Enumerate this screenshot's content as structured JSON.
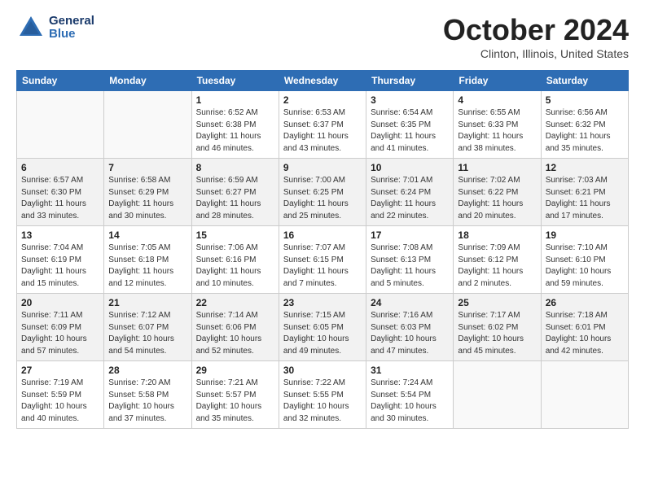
{
  "header": {
    "logo_general": "General",
    "logo_blue": "Blue",
    "month_title": "October 2024",
    "location": "Clinton, Illinois, United States"
  },
  "weekdays": [
    "Sunday",
    "Monday",
    "Tuesday",
    "Wednesday",
    "Thursday",
    "Friday",
    "Saturday"
  ],
  "weeks": [
    [
      {
        "day": "",
        "sunrise": "",
        "sunset": "",
        "daylight": ""
      },
      {
        "day": "",
        "sunrise": "",
        "sunset": "",
        "daylight": ""
      },
      {
        "day": "1",
        "sunrise": "Sunrise: 6:52 AM",
        "sunset": "Sunset: 6:38 PM",
        "daylight": "Daylight: 11 hours and 46 minutes."
      },
      {
        "day": "2",
        "sunrise": "Sunrise: 6:53 AM",
        "sunset": "Sunset: 6:37 PM",
        "daylight": "Daylight: 11 hours and 43 minutes."
      },
      {
        "day": "3",
        "sunrise": "Sunrise: 6:54 AM",
        "sunset": "Sunset: 6:35 PM",
        "daylight": "Daylight: 11 hours and 41 minutes."
      },
      {
        "day": "4",
        "sunrise": "Sunrise: 6:55 AM",
        "sunset": "Sunset: 6:33 PM",
        "daylight": "Daylight: 11 hours and 38 minutes."
      },
      {
        "day": "5",
        "sunrise": "Sunrise: 6:56 AM",
        "sunset": "Sunset: 6:32 PM",
        "daylight": "Daylight: 11 hours and 35 minutes."
      }
    ],
    [
      {
        "day": "6",
        "sunrise": "Sunrise: 6:57 AM",
        "sunset": "Sunset: 6:30 PM",
        "daylight": "Daylight: 11 hours and 33 minutes."
      },
      {
        "day": "7",
        "sunrise": "Sunrise: 6:58 AM",
        "sunset": "Sunset: 6:29 PM",
        "daylight": "Daylight: 11 hours and 30 minutes."
      },
      {
        "day": "8",
        "sunrise": "Sunrise: 6:59 AM",
        "sunset": "Sunset: 6:27 PM",
        "daylight": "Daylight: 11 hours and 28 minutes."
      },
      {
        "day": "9",
        "sunrise": "Sunrise: 7:00 AM",
        "sunset": "Sunset: 6:25 PM",
        "daylight": "Daylight: 11 hours and 25 minutes."
      },
      {
        "day": "10",
        "sunrise": "Sunrise: 7:01 AM",
        "sunset": "Sunset: 6:24 PM",
        "daylight": "Daylight: 11 hours and 22 minutes."
      },
      {
        "day": "11",
        "sunrise": "Sunrise: 7:02 AM",
        "sunset": "Sunset: 6:22 PM",
        "daylight": "Daylight: 11 hours and 20 minutes."
      },
      {
        "day": "12",
        "sunrise": "Sunrise: 7:03 AM",
        "sunset": "Sunset: 6:21 PM",
        "daylight": "Daylight: 11 hours and 17 minutes."
      }
    ],
    [
      {
        "day": "13",
        "sunrise": "Sunrise: 7:04 AM",
        "sunset": "Sunset: 6:19 PM",
        "daylight": "Daylight: 11 hours and 15 minutes."
      },
      {
        "day": "14",
        "sunrise": "Sunrise: 7:05 AM",
        "sunset": "Sunset: 6:18 PM",
        "daylight": "Daylight: 11 hours and 12 minutes."
      },
      {
        "day": "15",
        "sunrise": "Sunrise: 7:06 AM",
        "sunset": "Sunset: 6:16 PM",
        "daylight": "Daylight: 11 hours and 10 minutes."
      },
      {
        "day": "16",
        "sunrise": "Sunrise: 7:07 AM",
        "sunset": "Sunset: 6:15 PM",
        "daylight": "Daylight: 11 hours and 7 minutes."
      },
      {
        "day": "17",
        "sunrise": "Sunrise: 7:08 AM",
        "sunset": "Sunset: 6:13 PM",
        "daylight": "Daylight: 11 hours and 5 minutes."
      },
      {
        "day": "18",
        "sunrise": "Sunrise: 7:09 AM",
        "sunset": "Sunset: 6:12 PM",
        "daylight": "Daylight: 11 hours and 2 minutes."
      },
      {
        "day": "19",
        "sunrise": "Sunrise: 7:10 AM",
        "sunset": "Sunset: 6:10 PM",
        "daylight": "Daylight: 10 hours and 59 minutes."
      }
    ],
    [
      {
        "day": "20",
        "sunrise": "Sunrise: 7:11 AM",
        "sunset": "Sunset: 6:09 PM",
        "daylight": "Daylight: 10 hours and 57 minutes."
      },
      {
        "day": "21",
        "sunrise": "Sunrise: 7:12 AM",
        "sunset": "Sunset: 6:07 PM",
        "daylight": "Daylight: 10 hours and 54 minutes."
      },
      {
        "day": "22",
        "sunrise": "Sunrise: 7:14 AM",
        "sunset": "Sunset: 6:06 PM",
        "daylight": "Daylight: 10 hours and 52 minutes."
      },
      {
        "day": "23",
        "sunrise": "Sunrise: 7:15 AM",
        "sunset": "Sunset: 6:05 PM",
        "daylight": "Daylight: 10 hours and 49 minutes."
      },
      {
        "day": "24",
        "sunrise": "Sunrise: 7:16 AM",
        "sunset": "Sunset: 6:03 PM",
        "daylight": "Daylight: 10 hours and 47 minutes."
      },
      {
        "day": "25",
        "sunrise": "Sunrise: 7:17 AM",
        "sunset": "Sunset: 6:02 PM",
        "daylight": "Daylight: 10 hours and 45 minutes."
      },
      {
        "day": "26",
        "sunrise": "Sunrise: 7:18 AM",
        "sunset": "Sunset: 6:01 PM",
        "daylight": "Daylight: 10 hours and 42 minutes."
      }
    ],
    [
      {
        "day": "27",
        "sunrise": "Sunrise: 7:19 AM",
        "sunset": "Sunset: 5:59 PM",
        "daylight": "Daylight: 10 hours and 40 minutes."
      },
      {
        "day": "28",
        "sunrise": "Sunrise: 7:20 AM",
        "sunset": "Sunset: 5:58 PM",
        "daylight": "Daylight: 10 hours and 37 minutes."
      },
      {
        "day": "29",
        "sunrise": "Sunrise: 7:21 AM",
        "sunset": "Sunset: 5:57 PM",
        "daylight": "Daylight: 10 hours and 35 minutes."
      },
      {
        "day": "30",
        "sunrise": "Sunrise: 7:22 AM",
        "sunset": "Sunset: 5:55 PM",
        "daylight": "Daylight: 10 hours and 32 minutes."
      },
      {
        "day": "31",
        "sunrise": "Sunrise: 7:24 AM",
        "sunset": "Sunset: 5:54 PM",
        "daylight": "Daylight: 10 hours and 30 minutes."
      },
      {
        "day": "",
        "sunrise": "",
        "sunset": "",
        "daylight": ""
      },
      {
        "day": "",
        "sunrise": "",
        "sunset": "",
        "daylight": ""
      }
    ]
  ]
}
